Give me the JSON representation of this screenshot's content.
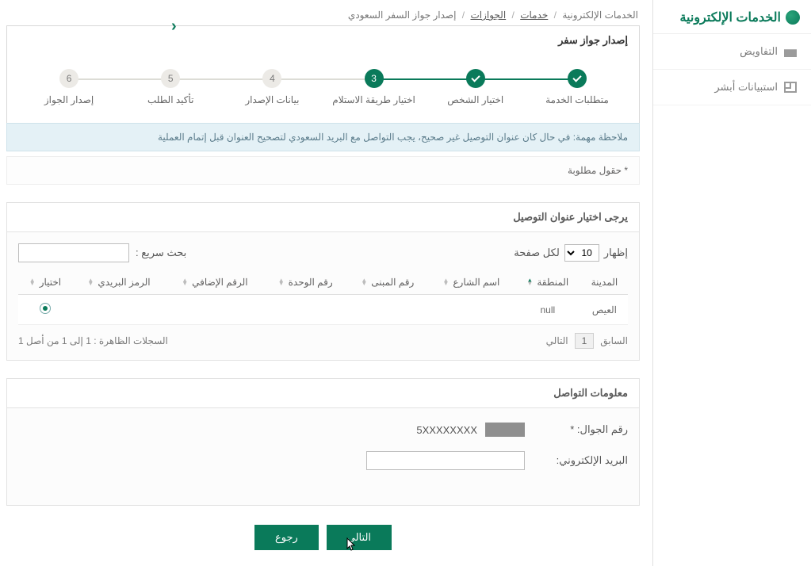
{
  "sidebar": {
    "title": "الخدمات الإلكترونية",
    "items": [
      {
        "label": "التفاويض"
      },
      {
        "label": "استبيانات أبشر"
      }
    ]
  },
  "breadcrumb": {
    "root": "الخدمات الإلكترونية",
    "l1": "خدمات",
    "l2": "الجوازات",
    "current": "إصدار جواز السفر السعودي"
  },
  "panel": {
    "title": "إصدار جواز سفر"
  },
  "steps": [
    {
      "label": "متطلبات الخدمة",
      "state": "done"
    },
    {
      "label": "اختيار الشخص",
      "state": "done"
    },
    {
      "label": "اختيار طريقة الاستلام",
      "state": "active",
      "num": "3"
    },
    {
      "label": "بيانات الإصدار",
      "state": "pending",
      "num": "4"
    },
    {
      "label": "تأكيد الطلب",
      "state": "pending",
      "num": "5"
    },
    {
      "label": "إصدار الجواز",
      "state": "pending",
      "num": "6"
    }
  ],
  "notice": "ملاحظة مهمة: في حال كان عنوان التوصيل غير صحيح، يجب التواصل مع البريد السعودي لتصحيح العنوان قبل إتمام العملية",
  "required_note": "* حقول مطلوبة",
  "address": {
    "title": "يرجى اختيار عنوان التوصيل",
    "show_label": "إظهار",
    "page_size_value": "10",
    "per_page": "لكل صفحة",
    "search_label": "بحث سريع :",
    "cols": {
      "city": "المدينة",
      "region": "المنطقة",
      "street": "اسم الشارع",
      "building": "رقم المبنى",
      "unit": "رقم الوحدة",
      "extra": "الرقم الإضافي",
      "postal": "الرمز البريدي",
      "choose": "اختيار"
    },
    "rows": [
      {
        "city": "العيص",
        "region": "null",
        "street": "",
        "building": "",
        "unit": "",
        "extra": "",
        "postal": "",
        "selected": true
      }
    ],
    "prev": "السابق",
    "page_num": "1",
    "next": "التالي",
    "summary": "السجلات الظاهرة : 1 إلى 1 من أصل 1"
  },
  "contact": {
    "title": "معلومات التواصل",
    "mobile_label": "رقم الجوال: *",
    "mobile_rest": "5XXXXXXXX",
    "email_label": "البريد الإلكتروني:"
  },
  "buttons": {
    "next": "التالي",
    "back": "رجوع"
  }
}
